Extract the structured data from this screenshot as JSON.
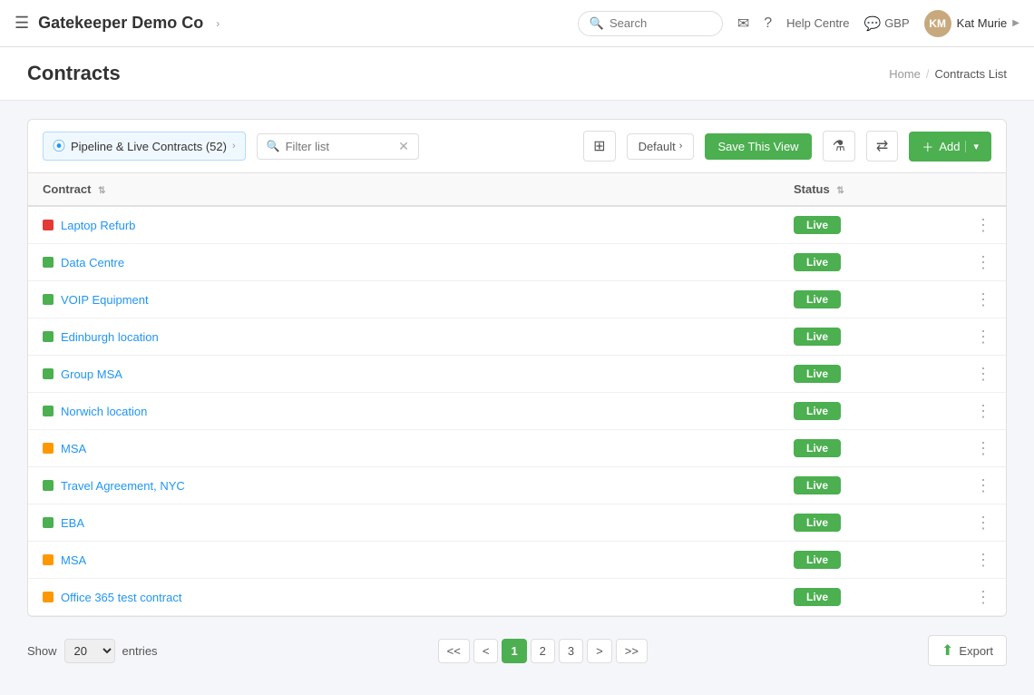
{
  "app": {
    "title": "Gatekeeper Demo Co",
    "title_caret": "›"
  },
  "nav": {
    "search_placeholder": "Search",
    "help_centre": "Help Centre",
    "currency": "GBP",
    "user_name": "Kat Murie",
    "user_initials": "KM"
  },
  "page": {
    "title": "Contracts",
    "breadcrumb_home": "Home",
    "breadcrumb_sep": "/",
    "breadcrumb_current": "Contracts List"
  },
  "toolbar": {
    "view_label": "Pipeline & Live Contracts (52)",
    "filter_placeholder": "Filter list",
    "default_label": "Default",
    "save_view_label": "Save This View",
    "add_label": "Add"
  },
  "table": {
    "columns": [
      {
        "key": "contract",
        "label": "Contract",
        "sortable": true
      },
      {
        "key": "status",
        "label": "Status",
        "sortable": true
      }
    ],
    "rows": [
      {
        "name": "Laptop Refurb",
        "color": "#e53935",
        "status": "Live"
      },
      {
        "name": "Data Centre",
        "color": "#4caf50",
        "status": "Live"
      },
      {
        "name": "VOIP Equipment",
        "color": "#4caf50",
        "status": "Live"
      },
      {
        "name": "Edinburgh location",
        "color": "#4caf50",
        "status": "Live"
      },
      {
        "name": "Group MSA",
        "color": "#4caf50",
        "status": "Live"
      },
      {
        "name": "Norwich location",
        "color": "#4caf50",
        "status": "Live"
      },
      {
        "name": "MSA",
        "color": "#ff9800",
        "status": "Live"
      },
      {
        "name": "Travel Agreement, NYC",
        "color": "#4caf50",
        "status": "Live"
      },
      {
        "name": "EBA",
        "color": "#4caf50",
        "status": "Live"
      },
      {
        "name": "MSA",
        "color": "#ff9800",
        "status": "Live"
      },
      {
        "name": "Office 365 test contract",
        "color": "#ff9800",
        "status": "Live"
      }
    ]
  },
  "pagination": {
    "show_label": "Show",
    "entries_label": "entries",
    "per_page": "20",
    "pages": [
      "1",
      "2",
      "3"
    ],
    "current_page": "1",
    "first_label": "<<",
    "prev_label": "<",
    "next_label": ">",
    "last_label": ">>"
  },
  "export": {
    "label": "Export"
  }
}
